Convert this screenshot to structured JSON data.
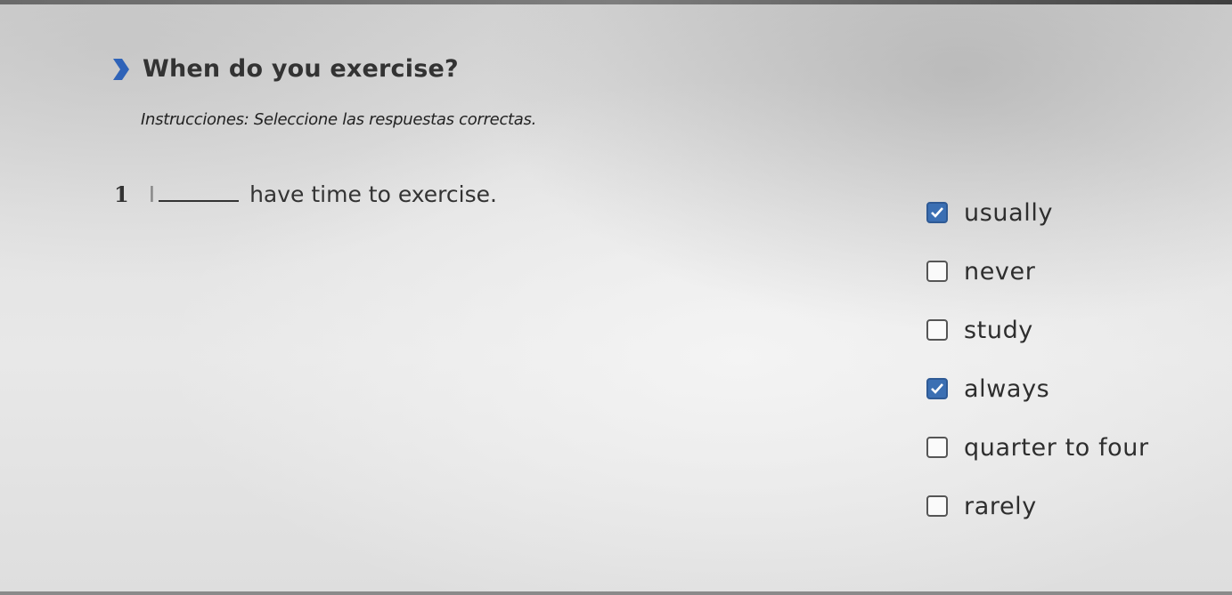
{
  "header": {
    "title": "When do you exercise?",
    "instructions": "Instrucciones: Seleccione las respuestas correctas."
  },
  "question": {
    "number": "1",
    "pre_blank": "I",
    "post_blank": "have time to exercise."
  },
  "options": [
    {
      "label": "usually",
      "checked": true
    },
    {
      "label": "never",
      "checked": false
    },
    {
      "label": "study",
      "checked": false
    },
    {
      "label": "always",
      "checked": true
    },
    {
      "label": "quarter to four",
      "checked": false
    },
    {
      "label": "rarely",
      "checked": false
    }
  ],
  "colors": {
    "checkbox_checked": "#3b6fb3",
    "chevron": "#2f63b8"
  },
  "icons": {
    "section_marker": "chevron-right-icon",
    "checked": "checkmark-icon"
  }
}
